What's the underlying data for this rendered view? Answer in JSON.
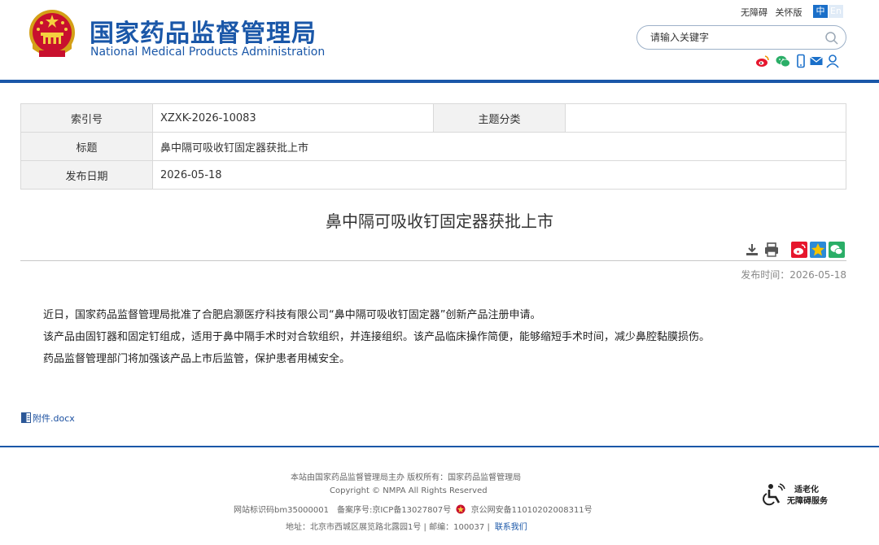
{
  "header": {
    "logo_cn": "国家药品监督管理局",
    "logo_en": "National Medical Products Administration",
    "top_links": [
      "无障碍",
      "关怀版"
    ],
    "lang_zh": "中",
    "lang_en": "En",
    "search_placeholder": "请输入关键字",
    "share_icons": [
      "weibo-icon",
      "wechat-icon",
      "mobile-icon",
      "mail-icon",
      "user-icon"
    ]
  },
  "meta": {
    "index_label": "索引号",
    "index_value": "XZXK-2026-10083",
    "category_label": "主题分类",
    "category_value": "",
    "title_label": "标题",
    "title_value": "鼻中隔可吸收钉固定器获批上市",
    "date_label": "发布日期",
    "date_value": "2026-05-18"
  },
  "article": {
    "title": "鼻中隔可吸收钉固定器获批上市",
    "pub_date": "发布时间：2026-05-18",
    "paragraphs": [
      "近日，国家药品监督管理局批准了合肥启灏医疗科技有限公司“鼻中隔可吸收钉固定器”创新产品注册申请。",
      "该产品由固钉器和固定钉组成，适用于鼻中隔手术时对合软组织，并连接组织。该产品临床操作简便，能够缩短手术时间，减少鼻腔黏膜损伤。",
      "药品监督管理部门将加强该产品上市后监管，保护患者用械安全。"
    ],
    "attachment": "附件.docx"
  },
  "footer": {
    "line1": "本站由国家药品监督管理局主办 版权所有：国家药品监督管理局",
    "line2": "Copyright © NMPA All Rights Reserved",
    "line3a": "网站标识码bm35000001　备案序号:京ICP备13027807号",
    "line3b": "京公网安备11010202008311号",
    "line4": "地址：北京市西城区展览路北露园1号 | 邮编：100037 |",
    "contact": "联系我们",
    "elder_t1": "适老化",
    "elder_t2": "无障碍服务"
  },
  "colors": {
    "brand_blue": "#1a57a8",
    "weibo_red": "#e6162d",
    "wechat_green": "#2aae67"
  }
}
